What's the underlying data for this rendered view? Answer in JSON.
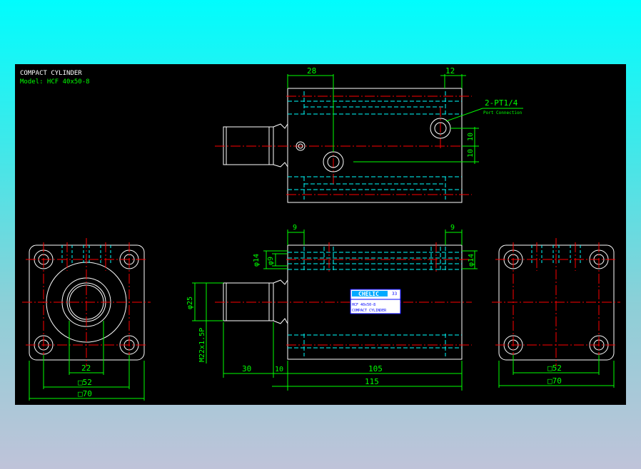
{
  "title_block": {
    "title": "COMPACT CYLINDER",
    "model": "Model: HCF 40x50-8"
  },
  "top_view": {
    "dim_left": "28",
    "dim_right": "12",
    "port_callout": "2-PT1/4",
    "port_sub": "Port Connection",
    "dim_v1": "10",
    "dim_v2": "10"
  },
  "front_view": {
    "dim_9_left": "9",
    "dim_9_right": "9",
    "dim_phi14_left": "φ14",
    "dim_phi9": "φ9",
    "dim_phi14_right": "φ14",
    "dim_phi25": "φ25",
    "dim_thread": "M22x1.5P",
    "dim_30": "30",
    "dim_10": "10",
    "dim_105": "105",
    "dim_115": "115",
    "label_brand": "CHELIC",
    "label_code": "33",
    "label_model": "HCF 40x50-8",
    "label_name": "COMPACT CYLINDER"
  },
  "left_view": {
    "dim_22": "22",
    "dim_52": "□52",
    "dim_70": "□70"
  },
  "right_view": {
    "dim_52": "□52",
    "dim_70": "□70"
  },
  "colors": {
    "drawing_bg": "#000000",
    "outline": "#ffffff",
    "centerline": "#ff0000",
    "hidden": "#00ffff",
    "dimension": "#00ff00",
    "label_bg": "#ffffff",
    "label_blue": "#0000ff"
  }
}
